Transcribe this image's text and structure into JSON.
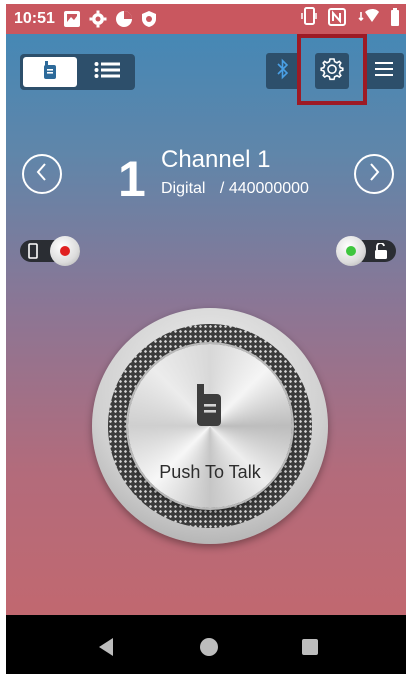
{
  "status_bar": {
    "time": "10:51",
    "icons_left": [
      "gallery-notification-icon",
      "settings-gear-icon",
      "data-usage-icon",
      "shield-icon"
    ],
    "icons_right": [
      "vibrate-icon",
      "nfc-icon",
      "wifi-icon",
      "battery-icon"
    ]
  },
  "toolbar": {
    "view_toggle": [
      "radio-view",
      "list-view"
    ],
    "active_view": "radio-view",
    "buttons": [
      "bluetooth-icon",
      "settings-icon",
      "menu-icon"
    ]
  },
  "channel": {
    "number": "1",
    "name": "Channel 1",
    "mode": "Digital",
    "separator": "/",
    "frequency": "440000000"
  },
  "ptt": {
    "label": "Push To Talk"
  },
  "colors": {
    "status_bar": "#c9575f",
    "gradient_top": "#3f88b8",
    "gradient_bottom": "#c7676b",
    "highlight": "#9d1a25",
    "toolbar_button": "#2d4f6b"
  }
}
